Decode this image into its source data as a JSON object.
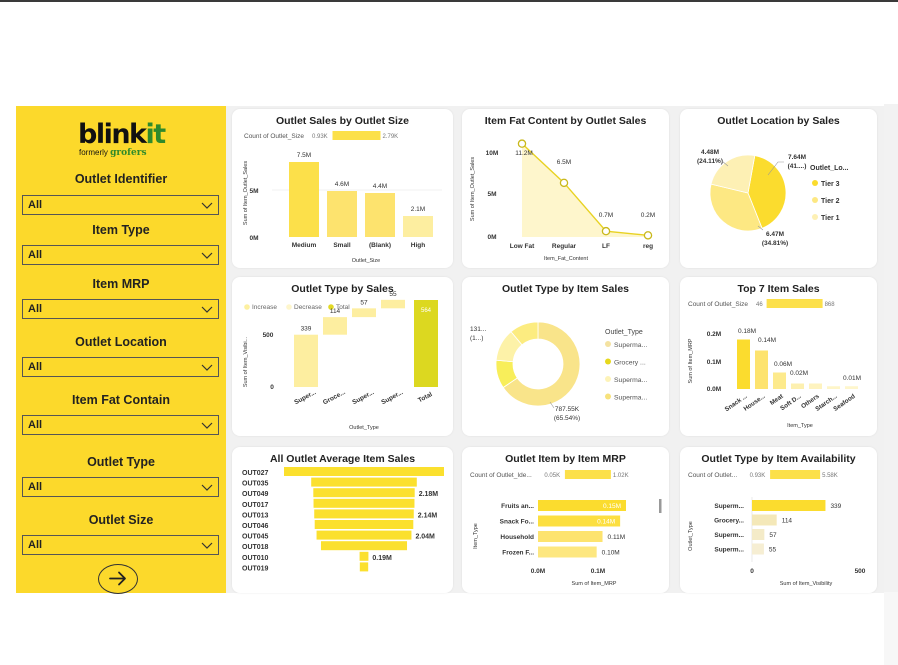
{
  "colors": {
    "sidebar": "#fcd92b",
    "canvas": "#f1f1f1",
    "bar": "#fce04a",
    "bar_light": "#fdeea0",
    "bar_pale": "#fef6cc",
    "line": "#e8d223",
    "total": "#d8d51c",
    "funnel": "#fbe02e"
  },
  "logo": {
    "brand_main": "blink",
    "brand_accent": "it",
    "formerly": "formerly",
    "formerly_name": "grofers"
  },
  "filters": [
    {
      "label": "Outlet Identifier",
      "value": "All"
    },
    {
      "label": "Item Type",
      "value": "All"
    },
    {
      "label": "Item MRP",
      "value": "All"
    },
    {
      "label": "Outlet Location",
      "value": "All"
    },
    {
      "label": "Item Fat Contain",
      "value": "All"
    },
    {
      "label": "Outlet Type",
      "value": "All"
    },
    {
      "label": "Outlet Size",
      "value": "All"
    }
  ],
  "next_icon": "arrow-right-circle-icon",
  "cards": {
    "c1": {
      "title": "Outlet Sales by Outlet Size",
      "legend_title": "Count of Outlet_Size",
      "legend_min": "0.93K",
      "legend_max": "2.79K",
      "ylabel": "Sum of Item_Outlet_Sales",
      "xlabel": "Outlet_Size",
      "yticks": [
        "5M",
        "0M"
      ]
    },
    "c2": {
      "title": "Item Fat Content by Outlet Sales",
      "ylabel": "Sum of Item_Outlet_Sales",
      "xlabel": "Item_Fat_Content",
      "yticks": [
        "10M",
        "5M",
        "0M"
      ]
    },
    "c3": {
      "title": "Outlet Location by Sales",
      "legend_title": "Outlet_Lo..."
    },
    "c4": {
      "title": "Outlet Type by Sales",
      "legend": [
        "Increase",
        "Decrease",
        "Total"
      ],
      "ylabel": "Sum of Item_Visibi...",
      "xlabel": "Outlet_Type",
      "yticks": [
        "500",
        "0"
      ]
    },
    "c5": {
      "title": "Outlet Type by Item Sales",
      "legend_title": "Outlet_Type"
    },
    "c6": {
      "title": "Top 7 Item Sales",
      "legend_title": "Count of Outlet_Size",
      "legend_min": "46",
      "legend_max": "868",
      "ylabel": "Sum of Item_MRP",
      "xlabel": "Item_Type",
      "yticks": [
        "0.2M",
        "0.1M",
        "0.0M"
      ]
    },
    "c7": {
      "title": "All Outlet Average Item Sales"
    },
    "c8": {
      "title": "Outlet Item by Item MRP",
      "legend_title": "Count of Outlet_Ide...",
      "legend_min": "0.05K",
      "legend_max": "1.02K",
      "ylabel": "Item_Type",
      "xlabel": "Sum of Item_MRP",
      "xticks": [
        "0.0M",
        "0.1M"
      ]
    },
    "c9": {
      "title": "Outlet Type by Item Availability",
      "legend_title": "Count of Outlet...",
      "legend_min": "0.93K",
      "legend_max": "5.58K",
      "ylabel": "Outlet_Type",
      "xlabel": "Sum of Item_Visibility",
      "xticks": [
        "0",
        "500"
      ]
    }
  },
  "chart_data": [
    {
      "type": "bar",
      "title": "Outlet Sales by Outlet Size",
      "categories": [
        "Medium",
        "Small",
        "(Blank)",
        "High"
      ],
      "values": [
        7.5,
        4.6,
        4.4,
        2.1
      ],
      "labels": [
        "7.5M",
        "4.6M",
        "4.4M",
        "2.1M"
      ],
      "ylim": [
        0,
        8
      ]
    },
    {
      "type": "area",
      "title": "Item Fat Content by Outlet Sales",
      "categories": [
        "Low Fat",
        "Regular",
        "LF",
        "reg"
      ],
      "values": [
        11.2,
        6.5,
        0.7,
        0.2
      ],
      "labels": [
        "11.2M",
        "6.5M",
        "0.7M",
        "0.2M"
      ],
      "ylim": [
        0,
        12
      ]
    },
    {
      "type": "pie",
      "title": "Outlet Location by Sales",
      "slices": [
        {
          "name": "Tier 3",
          "value": 7.64,
          "label": "7.64M",
          "pct": "(41....)"
        },
        {
          "name": "Tier 2",
          "value": 6.47,
          "label": "6.47M",
          "pct": "(34.81%)"
        },
        {
          "name": "Tier 1",
          "value": 4.48,
          "label": "4.48M",
          "pct": "(24.11%)"
        }
      ]
    },
    {
      "type": "bar",
      "title": "Outlet Type by Sales",
      "subtype": "waterfall",
      "categories": [
        "Super...",
        "Groce...",
        "Super...",
        "Super...",
        "Total"
      ],
      "values": [
        339,
        114,
        57,
        55,
        564
      ],
      "labels": [
        "339",
        "114",
        "57",
        "55",
        "564"
      ],
      "ylim": [
        0,
        600
      ]
    },
    {
      "type": "pie",
      "title": "Outlet Type by Item Sales",
      "subtype": "donut",
      "slices": [
        {
          "name": "Superma...",
          "value": 787.55,
          "label": "787.55K",
          "pct": "(65.54%)"
        },
        {
          "name": "Grocery ...",
          "value": 131,
          "label": "131...",
          "pct": "(1...)"
        },
        {
          "name": "Superma...",
          "value": 150
        },
        {
          "name": "Superma...",
          "value": 133
        }
      ]
    },
    {
      "type": "bar",
      "title": "Top 7 Item Sales",
      "categories": [
        "Snack ...",
        "House...",
        "Meat",
        "Soft D...",
        "Others",
        "Starch...",
        "Seafood"
      ],
      "values": [
        0.18,
        0.14,
        0.06,
        0.02,
        0.02,
        0.01,
        0.01
      ],
      "labels": [
        "0.18M",
        "0.14M",
        "0.06M",
        "0.02M",
        "",
        "",
        "0.01M"
      ],
      "ylim": [
        0,
        0.2
      ]
    },
    {
      "type": "bar",
      "title": "All Outlet Average Item Sales",
      "subtype": "funnel",
      "categories": [
        "OUT027",
        "OUT035",
        "OUT049",
        "OUT017",
        "OUT013",
        "OUT046",
        "OUT045",
        "OUT018",
        "OUT010",
        "OUT019"
      ],
      "values": [
        3.44,
        2.27,
        2.18,
        2.17,
        2.14,
        2.12,
        2.04,
        1.85,
        0.19,
        0.18
      ],
      "labels": [
        "",
        "",
        "2.18M",
        "",
        "2.14M",
        "",
        "2.04M",
        "",
        "0.19M",
        ""
      ]
    },
    {
      "type": "bar",
      "title": "Outlet Item by Item MRP",
      "orientation": "horizontal",
      "categories": [
        "Fruits an...",
        "Snack Fo...",
        "Household",
        "Frozen F..."
      ],
      "values": [
        0.15,
        0.14,
        0.11,
        0.1
      ],
      "labels": [
        "0.15M",
        "0.14M",
        "0.11M",
        "0.10M"
      ],
      "xlim": [
        0,
        0.15
      ]
    },
    {
      "type": "bar",
      "title": "Outlet Type by Item Availability",
      "orientation": "horizontal",
      "categories": [
        "Superm...",
        "Grocery...",
        "Superm...",
        "Superm..."
      ],
      "values": [
        339,
        114,
        57,
        55
      ],
      "labels": [
        "339",
        "114",
        "57",
        "55"
      ],
      "xlim": [
        0,
        600
      ]
    }
  ]
}
